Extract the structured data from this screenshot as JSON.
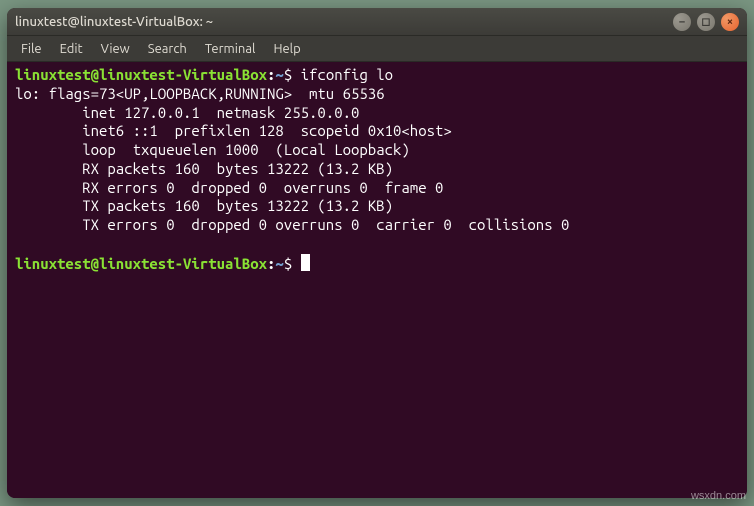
{
  "titlebar": {
    "title": "linuxtest@linuxtest-VirtualBox: ~"
  },
  "window_controls": {
    "min_glyph": "–",
    "max_glyph": "◻",
    "close_glyph": "×"
  },
  "menubar": {
    "items": [
      "File",
      "Edit",
      "View",
      "Search",
      "Terminal",
      "Help"
    ]
  },
  "prompt": {
    "userhost": "linuxtest@linuxtest-VirtualBox",
    "colon": ":",
    "path": "~",
    "dollar": "$"
  },
  "session": {
    "command1": "ifconfig lo",
    "output": [
      "lo: flags=73<UP,LOOPBACK,RUNNING>  mtu 65536",
      "        inet 127.0.0.1  netmask 255.0.0.0",
      "        inet6 ::1  prefixlen 128  scopeid 0x10<host>",
      "        loop  txqueuelen 1000  (Local Loopback)",
      "        RX packets 160  bytes 13222 (13.2 KB)",
      "        RX errors 0  dropped 0  overruns 0  frame 0",
      "        TX packets 160  bytes 13222 (13.2 KB)",
      "        TX errors 0  dropped 0 overruns 0  carrier 0  collisions 0"
    ]
  },
  "watermark": "wsxdn.com"
}
